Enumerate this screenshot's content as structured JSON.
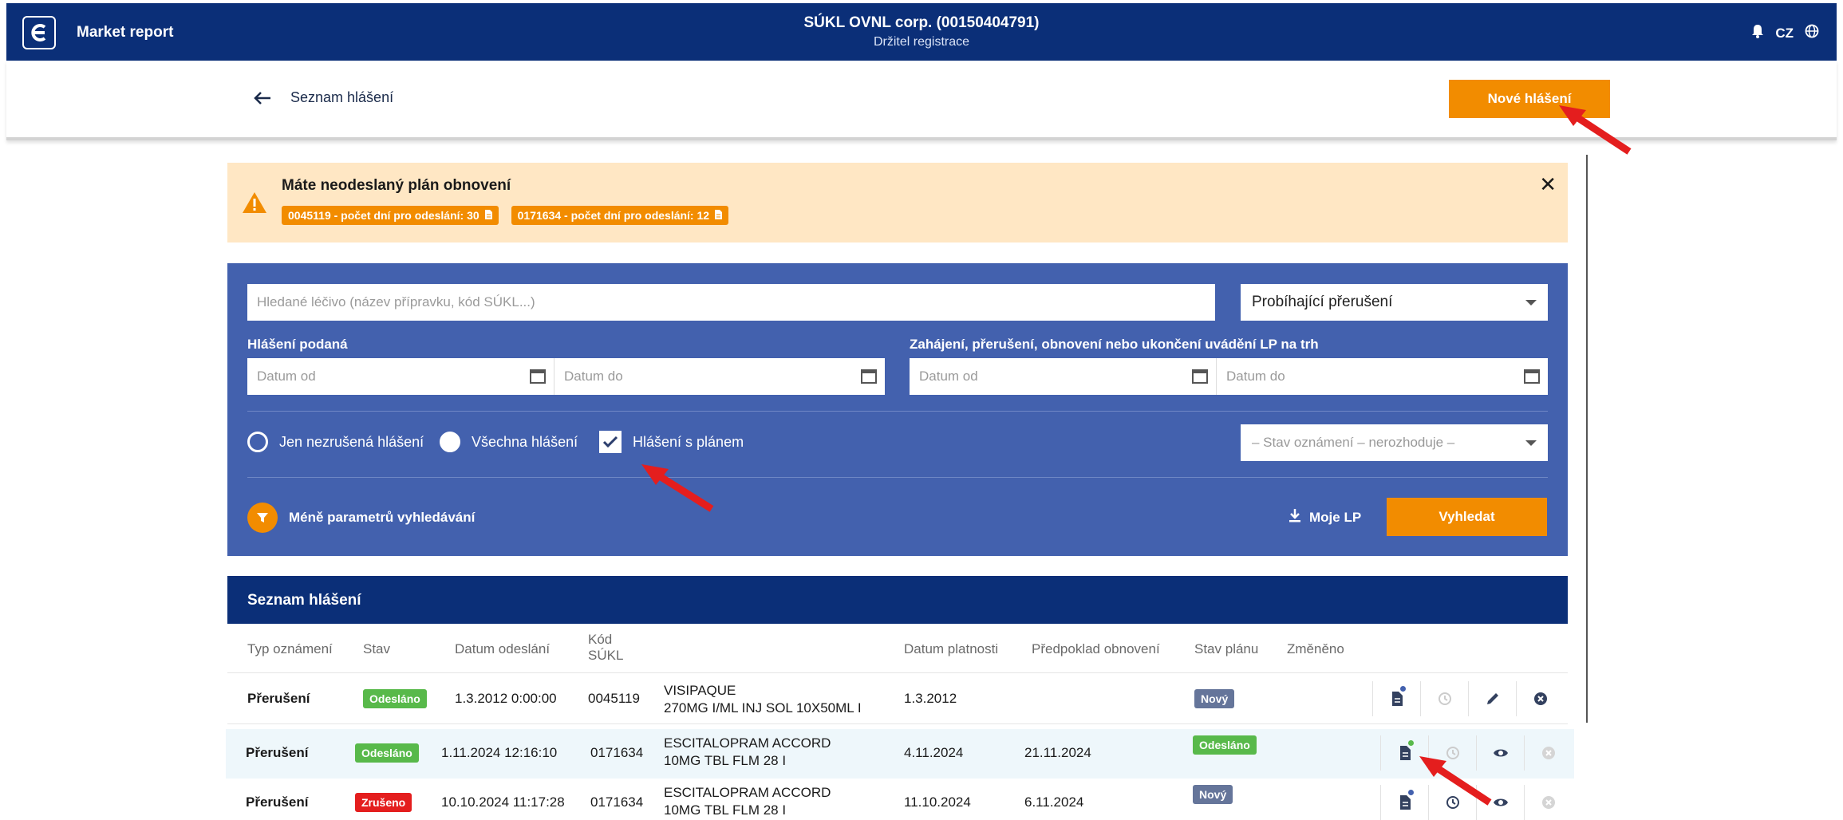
{
  "topbar": {
    "app_name": "Market report",
    "org": "SÚKL OVNL corp. (00150404791)",
    "role": "Držitel registrace",
    "lang": "CZ"
  },
  "subheader": {
    "back_label": "Seznam hlášení",
    "new_button": "Nové hlášení"
  },
  "alert": {
    "title": "Máte neodeslaný plán obnovení",
    "chips": [
      "0045119 - počet dní pro odeslání: 30",
      "0171634 - počet dní pro odeslání: 12"
    ]
  },
  "filter": {
    "search_placeholder": "Hledané léčivo (název přípravku, kód SÚKL...)",
    "status_select": "Probíhající přerušení",
    "submitted_label": "Hlášení podaná",
    "period_label": "Zahájení, přerušení, obnovení nebo ukončení uvádění LP na trh",
    "date_from": "Datum od",
    "date_to": "Datum do",
    "radio_uncancelled": "Jen nezrušená hlášení",
    "radio_all": "Všechna hlášení",
    "checkbox_plan": "Hlášení s plánem",
    "notice_state": "– Stav oznámení – nerozhoduje –",
    "less_params": "Méně parametrů vyhledávání",
    "my_lp": "Moje LP",
    "search_button": "Vyhledat"
  },
  "list": {
    "title": "Seznam hlášení",
    "columns": [
      "Typ oznámení",
      "Stav",
      "Datum odeslání",
      "Kód SÚKL",
      "Datum platnosti",
      "Předpoklad obnovení",
      "Stav plánu",
      "Změněno"
    ],
    "rows": [
      {
        "type": "Přerušení",
        "status": "Odesláno",
        "sent": "1.3.2012 0:00:00",
        "code": "0045119",
        "name1": "VISIPAQUE",
        "name2": "270MG I/ML INJ SOL 10X50ML I",
        "valid": "1.3.2012",
        "renewal": "",
        "plan": "Nový"
      },
      {
        "type": "Přerušení",
        "status": "Odesláno",
        "sent": "1.11.2024 12:16:10",
        "code": "0171634",
        "name1": "ESCITALOPRAM ACCORD",
        "name2": "10MG TBL FLM 28 I",
        "valid": "4.11.2024",
        "renewal": "21.11.2024",
        "plan": "Odesláno"
      },
      {
        "type": "Přerušení",
        "status": "Zrušeno",
        "sent": "10.10.2024 11:17:28",
        "code": "0171634",
        "name1": "ESCITALOPRAM ACCORD",
        "name2": "10MG TBL FLM 28 I",
        "valid": "11.10.2024",
        "renewal": "6.11.2024",
        "plan": "Nový"
      }
    ]
  },
  "colors": {
    "navy": "#0b2f78",
    "filter_bg": "#4361ae",
    "orange": "#f28c00",
    "alert_bg": "#ffe7c4",
    "green": "#58b94a",
    "red": "#e41e1e",
    "gray_badge": "#65759a"
  }
}
